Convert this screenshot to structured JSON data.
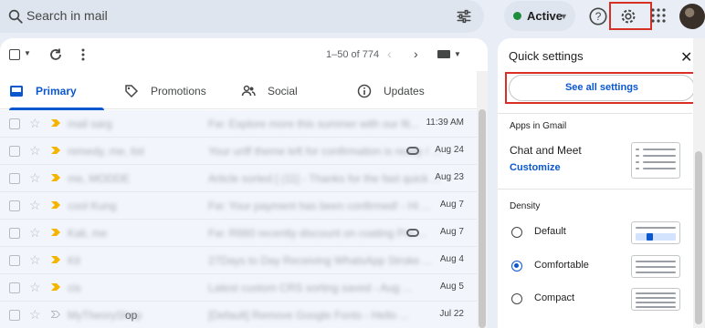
{
  "search": {
    "placeholder": "Search in mail",
    "search_icon": "search-icon",
    "filter_icon": "tune-icon"
  },
  "status": {
    "label": "Active",
    "color": "#1e8e3e"
  },
  "header_icons": [
    "help-icon",
    "settings-gear-icon",
    "apps-grid-icon",
    "account-avatar"
  ],
  "toolbar": {
    "range": "1–50 of 774"
  },
  "tabs": [
    {
      "label": "Primary",
      "icon": "inbox-icon",
      "active": true
    },
    {
      "label": "Promotions",
      "icon": "tag-icon",
      "active": false
    },
    {
      "label": "Social",
      "icon": "people-icon",
      "active": false
    },
    {
      "label": "Updates",
      "icon": "info-icon",
      "active": false
    }
  ],
  "emails": [
    {
      "sender": "mail sarg",
      "subject": "Fw: Explore more this summer with our fit...",
      "date": "11:39 AM",
      "attachment": false,
      "important": true
    },
    {
      "sender": "remedy, me, list",
      "subject": "Your uriff theme left for confirmation is ready / ...",
      "date": "Aug 24",
      "attachment": true,
      "important": true
    },
    {
      "sender": "me, MODDE",
      "subject": "Article sorted [ (11] - Thanks for the fast quick ...",
      "date": "Aug 23",
      "attachment": false,
      "important": true
    },
    {
      "sender": "cool Kung",
      "subject": "Fw: Your payment has been confirmed! - Hi ...",
      "date": "Aug 7",
      "attachment": false,
      "important": true
    },
    {
      "sender": "Kali, me",
      "subject": "Fw: R660 recently discount on coating Pro ...",
      "date": "Aug 7",
      "attachment": true,
      "important": true
    },
    {
      "sender": "Kit",
      "subject": "27Days to Day Receiving WhatsApp Stroke ...",
      "date": "Aug 4",
      "attachment": false,
      "important": true
    },
    {
      "sender": "cis",
      "subject": "Latest custom CRS sorting saved - Aug ...",
      "date": "Aug 5",
      "attachment": false,
      "important": true
    },
    {
      "sender": "MyTheoryShop",
      "sender_visible_fragment": "op",
      "subject": "[Default] Remove Google Fonts - Hello ...",
      "date": "Jul 22",
      "attachment": false,
      "important": false
    }
  ],
  "quick_settings": {
    "title": "Quick settings",
    "see_all": "See all settings",
    "apps_section": "Apps in Gmail",
    "chat_label": "Chat and Meet",
    "customize": "Customize",
    "density_section": "Density",
    "density_options": [
      {
        "label": "Default",
        "selected": false
      },
      {
        "label": "Comfortable",
        "selected": true
      },
      {
        "label": "Compact",
        "selected": false
      }
    ]
  },
  "colors": {
    "accent": "#0b57d0",
    "highlight": "#d93025",
    "important": "#f4b400"
  }
}
